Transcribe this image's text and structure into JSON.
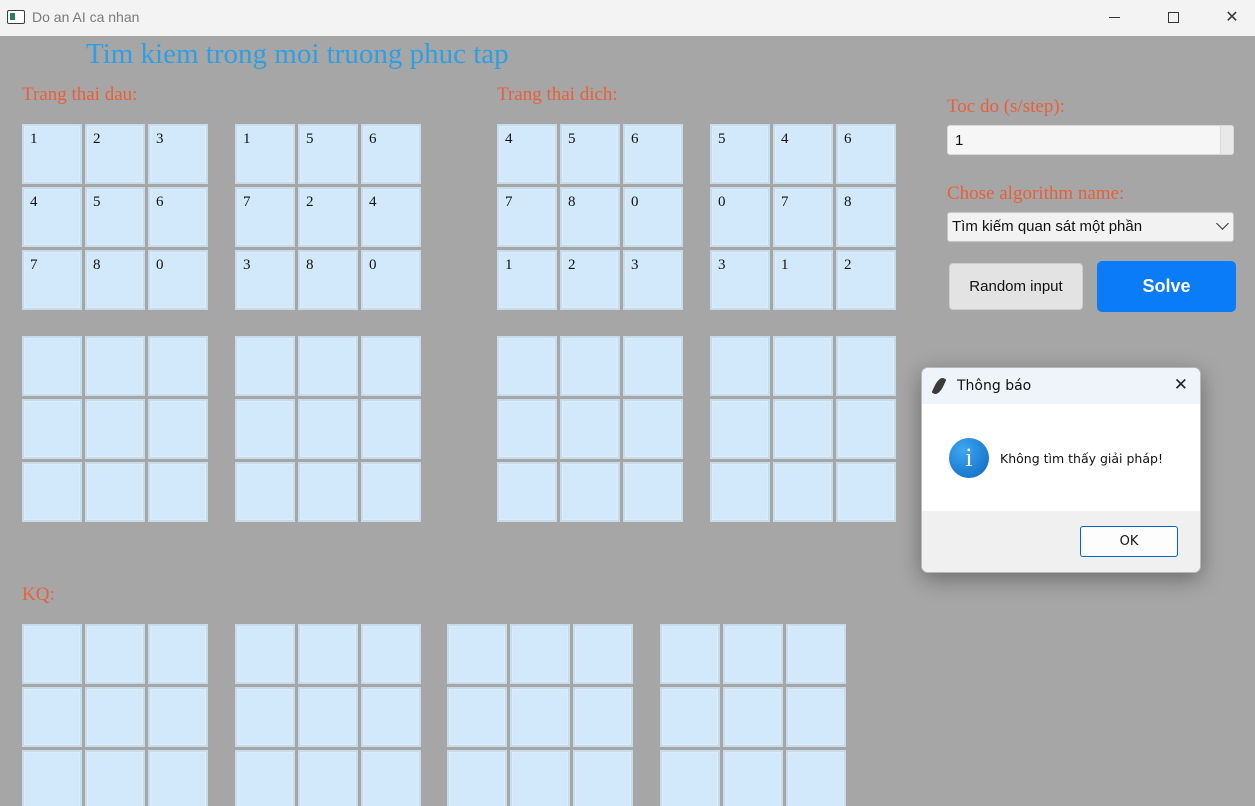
{
  "window": {
    "title": "Do an AI ca nhan",
    "min_label": "",
    "max_label": "",
    "close_label": "✕"
  },
  "heading": "Tim kiem trong moi truong phuc tap",
  "labels": {
    "start": "Trang thai dau:",
    "goal": "Trang thai dich:",
    "speed": "Toc do (s/step):",
    "algo": "Chose algorithm name:",
    "result": "KQ:"
  },
  "start_boards": [
    [
      "1",
      "2",
      "3",
      "4",
      "5",
      "6",
      "7",
      "8",
      "0"
    ],
    [
      "1",
      "5",
      "6",
      "7",
      "2",
      "4",
      "3",
      "8",
      "0"
    ],
    [
      "",
      "",
      "",
      "",
      "",
      "",
      "",
      "",
      ""
    ],
    [
      "",
      "",
      "",
      "",
      "",
      "",
      "",
      "",
      ""
    ]
  ],
  "goal_boards": [
    [
      "4",
      "5",
      "6",
      "7",
      "8",
      "0",
      "1",
      "2",
      "3"
    ],
    [
      "5",
      "4",
      "6",
      "0",
      "7",
      "8",
      "3",
      "1",
      "2"
    ],
    [
      "",
      "",
      "",
      "",
      "",
      "",
      "",
      "",
      ""
    ],
    [
      "",
      "",
      "",
      "",
      "",
      "",
      "",
      "",
      ""
    ]
  ],
  "result_boards": [
    [
      "",
      "",
      "",
      "",
      "",
      "",
      "",
      "",
      ""
    ],
    [
      "",
      "",
      "",
      "",
      "",
      "",
      "",
      "",
      ""
    ],
    [
      "",
      "",
      "",
      "",
      "",
      "",
      "",
      "",
      ""
    ],
    [
      "",
      "",
      "",
      "",
      "",
      "",
      "",
      "",
      ""
    ]
  ],
  "speed_value": "1",
  "algorithm_selected": "Tìm kiếm quan sát một phần",
  "buttons": {
    "random": "Random input",
    "solve": "Solve"
  },
  "colors": {
    "accent_blue": "#0b7cf7",
    "heading_blue": "#2f9fe3",
    "label_orange": "#e8603a",
    "cell_bg": "#d1e9fa",
    "background": "#a6a6a6"
  },
  "dialog": {
    "title": "Thông báo",
    "icon": "info-icon",
    "message": "Không tìm thấy giải pháp!",
    "ok_label": "OK",
    "close_label": "✕"
  }
}
